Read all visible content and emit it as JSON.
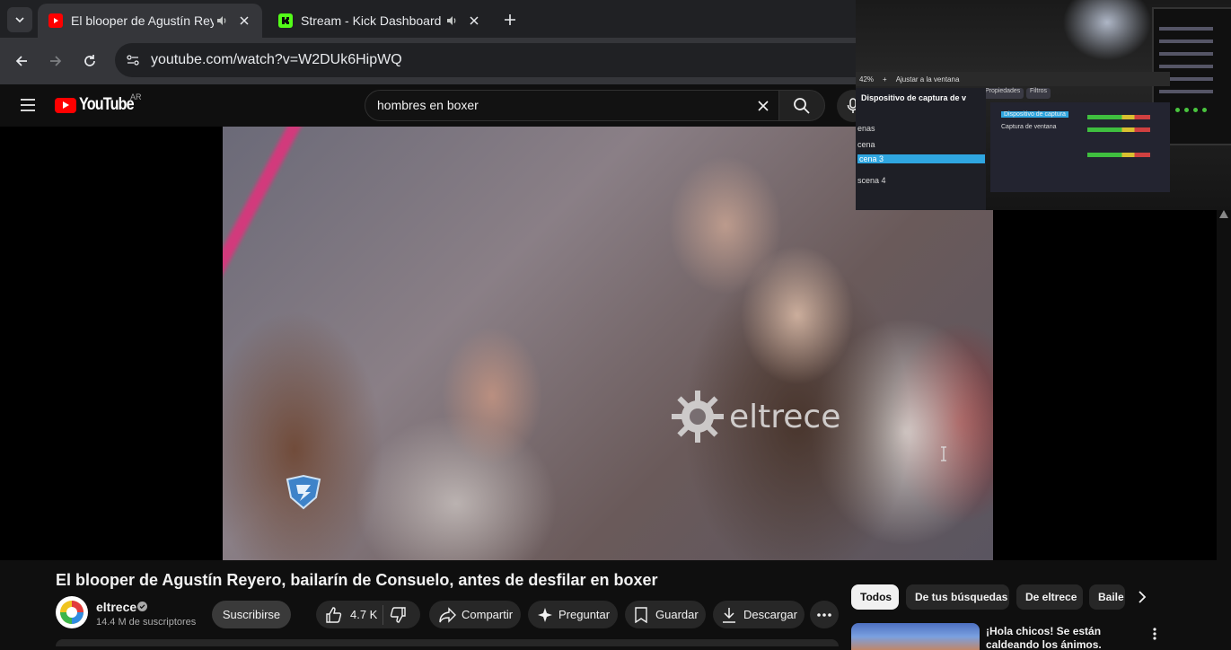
{
  "browser": {
    "tabs": [
      {
        "title": "El blooper de Agustín Reyero",
        "favicon": "youtube-icon",
        "active": true
      },
      {
        "title": "Stream - Kick Dashboard",
        "favicon": "kick-icon",
        "active": false
      }
    ],
    "url": "youtube.com/watch?v=W2DUk6HipWQ"
  },
  "youtube": {
    "logo_text": "YouTube",
    "country_code": "AR",
    "search_query": "hombres en boxer"
  },
  "video": {
    "watermark_text": "eltrece",
    "title": "El blooper de Agustín Reyero, bailarín de Consuelo, antes de desfilar en boxer",
    "channel": {
      "name": "eltrece",
      "subscribers": "14.4 M de suscriptores",
      "verified": true
    },
    "subscribe_label": "Suscribirse",
    "likes": "4.7 K",
    "actions": {
      "share": "Compartir",
      "ask": "Preguntar",
      "save": "Guardar",
      "download": "Descargar"
    }
  },
  "chips": [
    "Todos",
    "De tus búsquedas",
    "De eltrece",
    "Baile"
  ],
  "recommendation": {
    "title": "¡Hola chicos! Se están caldeando los ánimos, ¿no? |"
  },
  "pip_overlay": {
    "zoom": "42%",
    "fit_label": "Ajustar a la ventana",
    "source_label": "Dispositivo de captura de v",
    "properties": "Propiedades",
    "filters": "Filtros",
    "scenes": [
      "enas",
      "cena",
      "cena 3",
      "scena 4"
    ],
    "source_items": [
      "Dispositivo de captura",
      "Captura de ventana"
    ]
  },
  "colors": {
    "accent_red": "#ff0000",
    "kick_green": "#53fc18",
    "background": "#0f0f0f"
  }
}
